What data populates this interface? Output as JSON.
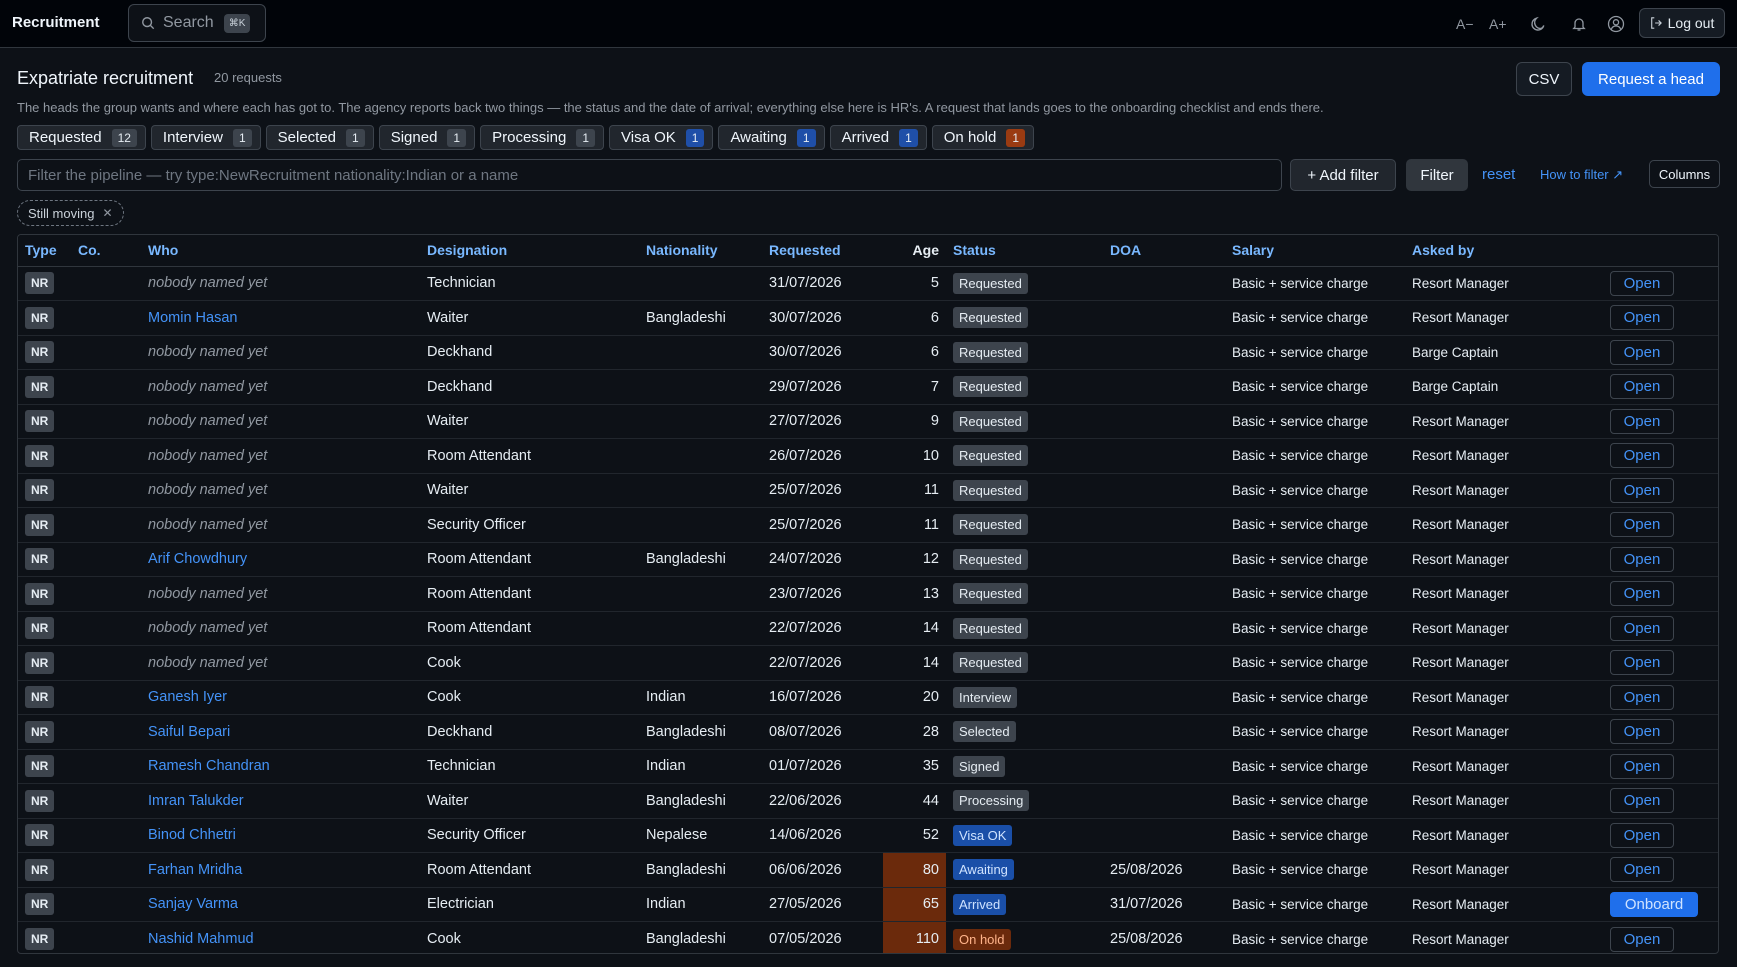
{
  "header": {
    "app_title": "Recruitment",
    "search_placeholder": "Search",
    "search_shortcut": "⌘K",
    "font_smaller": "A−",
    "font_larger": "A+",
    "logout_label": "Log out"
  },
  "page": {
    "title": "Expatriate recruitment",
    "count": "20 requests",
    "description": "The heads the group wants and where each has got to. The agency reports back two things — the status and the date of arrival; everything else here is HR's. A request that lands goes to the onboarding checklist and ends there.",
    "csv_label": "CSV",
    "request_label": "Request a head"
  },
  "status_chips": [
    {
      "label": "Requested",
      "count": "12",
      "tone": "grey"
    },
    {
      "label": "Interview",
      "count": "1",
      "tone": "grey"
    },
    {
      "label": "Selected",
      "count": "1",
      "tone": "grey"
    },
    {
      "label": "Signed",
      "count": "1",
      "tone": "grey"
    },
    {
      "label": "Processing",
      "count": "1",
      "tone": "grey"
    },
    {
      "label": "Visa OK",
      "count": "1",
      "tone": "blue"
    },
    {
      "label": "Awaiting",
      "count": "1",
      "tone": "blue"
    },
    {
      "label": "Arrived",
      "count": "1",
      "tone": "blue"
    },
    {
      "label": "On hold",
      "count": "1",
      "tone": "orange"
    }
  ],
  "filter": {
    "placeholder": "Filter the pipeline — try type:NewRecruitment nationality:Indian or a name",
    "add_filter_label": "+ Add filter",
    "filter_label": "Filter",
    "reset_label": "reset",
    "how_to_label": "How to filter ↗",
    "columns_label": "Columns",
    "active_pill": "Still moving"
  },
  "table": {
    "columns": [
      "Type",
      "Co.",
      "Who",
      "Designation",
      "Nationality",
      "Requested",
      "Age",
      "Status",
      "DOA",
      "Salary",
      "Asked by",
      ""
    ],
    "rows": [
      {
        "type": "NR",
        "co": "",
        "who": "nobody named yet",
        "named": false,
        "designation": "Technician",
        "nationality": "",
        "requested": "31/07/2026",
        "age": "5",
        "age_warn": false,
        "status": "Requested",
        "status_tone": "grey",
        "doa": "",
        "salary": "Basic + service charge",
        "asked_by": "Resort Manager",
        "action": "Open",
        "action_primary": false
      },
      {
        "type": "NR",
        "co": "",
        "who": "Momin Hasan",
        "named": true,
        "designation": "Waiter",
        "nationality": "Bangladeshi",
        "requested": "30/07/2026",
        "age": "6",
        "age_warn": false,
        "status": "Requested",
        "status_tone": "grey",
        "doa": "",
        "salary": "Basic + service charge",
        "asked_by": "Resort Manager",
        "action": "Open",
        "action_primary": false
      },
      {
        "type": "NR",
        "co": "",
        "who": "nobody named yet",
        "named": false,
        "designation": "Deckhand",
        "nationality": "",
        "requested": "30/07/2026",
        "age": "6",
        "age_warn": false,
        "status": "Requested",
        "status_tone": "grey",
        "doa": "",
        "salary": "Basic + service charge",
        "asked_by": "Barge Captain",
        "action": "Open",
        "action_primary": false
      },
      {
        "type": "NR",
        "co": "",
        "who": "nobody named yet",
        "named": false,
        "designation": "Deckhand",
        "nationality": "",
        "requested": "29/07/2026",
        "age": "7",
        "age_warn": false,
        "status": "Requested",
        "status_tone": "grey",
        "doa": "",
        "salary": "Basic + service charge",
        "asked_by": "Barge Captain",
        "action": "Open",
        "action_primary": false
      },
      {
        "type": "NR",
        "co": "",
        "who": "nobody named yet",
        "named": false,
        "designation": "Waiter",
        "nationality": "",
        "requested": "27/07/2026",
        "age": "9",
        "age_warn": false,
        "status": "Requested",
        "status_tone": "grey",
        "doa": "",
        "salary": "Basic + service charge",
        "asked_by": "Resort Manager",
        "action": "Open",
        "action_primary": false
      },
      {
        "type": "NR",
        "co": "",
        "who": "nobody named yet",
        "named": false,
        "designation": "Room Attendant",
        "nationality": "",
        "requested": "26/07/2026",
        "age": "10",
        "age_warn": false,
        "status": "Requested",
        "status_tone": "grey",
        "doa": "",
        "salary": "Basic + service charge",
        "asked_by": "Resort Manager",
        "action": "Open",
        "action_primary": false
      },
      {
        "type": "NR",
        "co": "",
        "who": "nobody named yet",
        "named": false,
        "designation": "Waiter",
        "nationality": "",
        "requested": "25/07/2026",
        "age": "11",
        "age_warn": false,
        "status": "Requested",
        "status_tone": "grey",
        "doa": "",
        "salary": "Basic + service charge",
        "asked_by": "Resort Manager",
        "action": "Open",
        "action_primary": false
      },
      {
        "type": "NR",
        "co": "",
        "who": "nobody named yet",
        "named": false,
        "designation": "Security Officer",
        "nationality": "",
        "requested": "25/07/2026",
        "age": "11",
        "age_warn": false,
        "status": "Requested",
        "status_tone": "grey",
        "doa": "",
        "salary": "Basic + service charge",
        "asked_by": "Resort Manager",
        "action": "Open",
        "action_primary": false
      },
      {
        "type": "NR",
        "co": "",
        "who": "Arif Chowdhury",
        "named": true,
        "designation": "Room Attendant",
        "nationality": "Bangladeshi",
        "requested": "24/07/2026",
        "age": "12",
        "age_warn": false,
        "status": "Requested",
        "status_tone": "grey",
        "doa": "",
        "salary": "Basic + service charge",
        "asked_by": "Resort Manager",
        "action": "Open",
        "action_primary": false
      },
      {
        "type": "NR",
        "co": "",
        "who": "nobody named yet",
        "named": false,
        "designation": "Room Attendant",
        "nationality": "",
        "requested": "23/07/2026",
        "age": "13",
        "age_warn": false,
        "status": "Requested",
        "status_tone": "grey",
        "doa": "",
        "salary": "Basic + service charge",
        "asked_by": "Resort Manager",
        "action": "Open",
        "action_primary": false
      },
      {
        "type": "NR",
        "co": "",
        "who": "nobody named yet",
        "named": false,
        "designation": "Room Attendant",
        "nationality": "",
        "requested": "22/07/2026",
        "age": "14",
        "age_warn": false,
        "status": "Requested",
        "status_tone": "grey",
        "doa": "",
        "salary": "Basic + service charge",
        "asked_by": "Resort Manager",
        "action": "Open",
        "action_primary": false
      },
      {
        "type": "NR",
        "co": "",
        "who": "nobody named yet",
        "named": false,
        "designation": "Cook",
        "nationality": "",
        "requested": "22/07/2026",
        "age": "14",
        "age_warn": false,
        "status": "Requested",
        "status_tone": "grey",
        "doa": "",
        "salary": "Basic + service charge",
        "asked_by": "Resort Manager",
        "action": "Open",
        "action_primary": false
      },
      {
        "type": "NR",
        "co": "",
        "who": "Ganesh Iyer",
        "named": true,
        "designation": "Cook",
        "nationality": "Indian",
        "requested": "16/07/2026",
        "age": "20",
        "age_warn": false,
        "status": "Interview",
        "status_tone": "grey",
        "doa": "",
        "salary": "Basic + service charge",
        "asked_by": "Resort Manager",
        "action": "Open",
        "action_primary": false
      },
      {
        "type": "NR",
        "co": "",
        "who": "Saiful Bepari",
        "named": true,
        "designation": "Deckhand",
        "nationality": "Bangladeshi",
        "requested": "08/07/2026",
        "age": "28",
        "age_warn": false,
        "status": "Selected",
        "status_tone": "grey",
        "doa": "",
        "salary": "Basic + service charge",
        "asked_by": "Resort Manager",
        "action": "Open",
        "action_primary": false
      },
      {
        "type": "NR",
        "co": "",
        "who": "Ramesh Chandran",
        "named": true,
        "designation": "Technician",
        "nationality": "Indian",
        "requested": "01/07/2026",
        "age": "35",
        "age_warn": false,
        "status": "Signed",
        "status_tone": "grey",
        "doa": "",
        "salary": "Basic + service charge",
        "asked_by": "Resort Manager",
        "action": "Open",
        "action_primary": false
      },
      {
        "type": "NR",
        "co": "",
        "who": "Imran Talukder",
        "named": true,
        "designation": "Waiter",
        "nationality": "Bangladeshi",
        "requested": "22/06/2026",
        "age": "44",
        "age_warn": false,
        "status": "Processing",
        "status_tone": "grey",
        "doa": "",
        "salary": "Basic + service charge",
        "asked_by": "Resort Manager",
        "action": "Open",
        "action_primary": false
      },
      {
        "type": "NR",
        "co": "",
        "who": "Binod Chhetri",
        "named": true,
        "designation": "Security Officer",
        "nationality": "Nepalese",
        "requested": "14/06/2026",
        "age": "52",
        "age_warn": false,
        "status": "Visa OK",
        "status_tone": "blue",
        "doa": "",
        "salary": "Basic + service charge",
        "asked_by": "Resort Manager",
        "action": "Open",
        "action_primary": false
      },
      {
        "type": "NR",
        "co": "",
        "who": "Farhan Mridha",
        "named": true,
        "designation": "Room Attendant",
        "nationality": "Bangladeshi",
        "requested": "06/06/2026",
        "age": "80",
        "age_warn": true,
        "status": "Awaiting",
        "status_tone": "blue",
        "doa": "25/08/2026",
        "salary": "Basic + service charge",
        "asked_by": "Resort Manager",
        "action": "Open",
        "action_primary": false
      },
      {
        "type": "NR",
        "co": "",
        "who": "Sanjay Varma",
        "named": true,
        "designation": "Electrician",
        "nationality": "Indian",
        "requested": "27/05/2026",
        "age": "65",
        "age_warn": true,
        "status": "Arrived",
        "status_tone": "blue",
        "doa": "31/07/2026",
        "salary": "Basic + service charge",
        "asked_by": "Resort Manager",
        "action": "Onboard",
        "action_primary": true
      },
      {
        "type": "NR",
        "co": "",
        "who": "Nashid Mahmud",
        "named": true,
        "designation": "Cook",
        "nationality": "Bangladeshi",
        "requested": "07/05/2026",
        "age": "110",
        "age_warn": true,
        "status": "On hold",
        "status_tone": "orange",
        "doa": "25/08/2026",
        "salary": "Basic + service charge",
        "asked_by": "Resort Manager",
        "action": "Open",
        "action_primary": false
      }
    ]
  }
}
